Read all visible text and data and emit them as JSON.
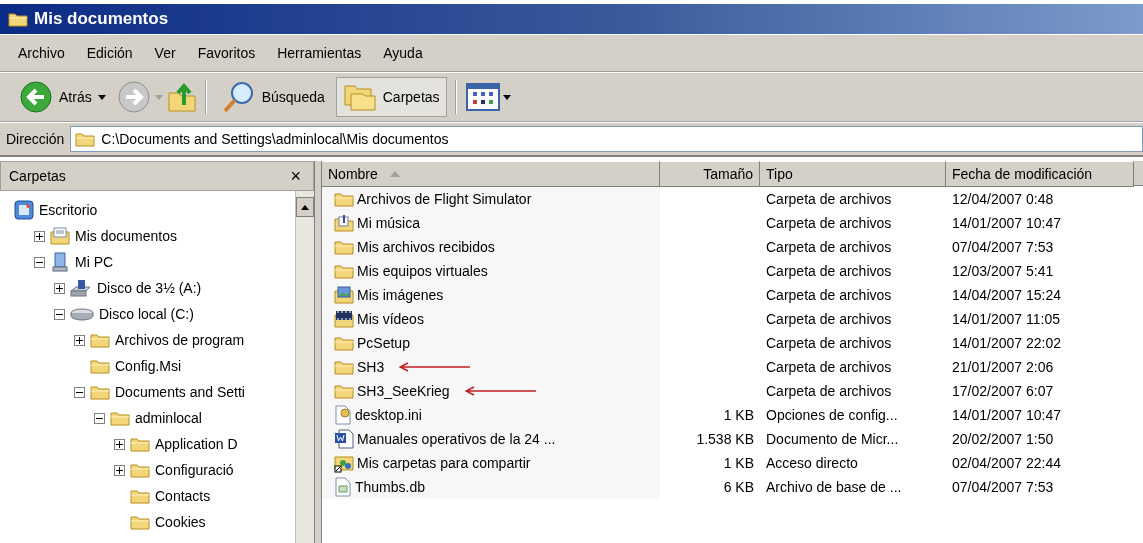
{
  "window": {
    "title": "Mis documentos"
  },
  "menu": [
    "Archivo",
    "Edición",
    "Ver",
    "Favoritos",
    "Herramientas",
    "Ayuda"
  ],
  "toolbar": {
    "back": "Atrás",
    "search": "Búsqueda",
    "folders": {
      "label": "Carpetas",
      "pressed": true
    }
  },
  "address": {
    "label": "Dirección",
    "value": "C:\\Documents and Settings\\adminlocal\\Mis documentos"
  },
  "folders_pane": {
    "title": "Carpetas",
    "close": "×",
    "tree": [
      {
        "label": "Escritorio",
        "kind": "desktop",
        "children": [
          {
            "label": "Mis documentos",
            "kind": "documents",
            "expanded": false
          },
          {
            "label": "Mi PC",
            "kind": "computer",
            "expanded": true,
            "children": [
              {
                "label": "Disco de 3½ (A:)",
                "kind": "floppy",
                "expanded": false
              },
              {
                "label": "Disco local (C:)",
                "kind": "drive",
                "expanded": true,
                "children": [
                  {
                    "label": "Archivos de program",
                    "kind": "folder",
                    "expanded": false
                  },
                  {
                    "label": "Config.Msi",
                    "kind": "folder"
                  },
                  {
                    "label": "Documents and Setti",
                    "kind": "folder",
                    "expanded": true,
                    "children": [
                      {
                        "label": "adminlocal",
                        "kind": "folder",
                        "expanded": true,
                        "children": [
                          {
                            "label": "Application D",
                            "kind": "folder",
                            "expanded": false
                          },
                          {
                            "label": "Configuració",
                            "kind": "folder",
                            "expanded": false
                          },
                          {
                            "label": "Contacts",
                            "kind": "folder"
                          },
                          {
                            "label": "Cookies",
                            "kind": "folder"
                          }
                        ]
                      }
                    ]
                  }
                ]
              }
            ]
          }
        ]
      }
    ]
  },
  "table": {
    "columns": [
      {
        "label": "Nombre",
        "sorted": true
      },
      {
        "label": "Tamaño",
        "sorted": false
      },
      {
        "label": "Tipo",
        "sorted": false
      },
      {
        "label": "Fecha de modificación",
        "sorted": false
      }
    ],
    "rows": [
      {
        "kind": "folder",
        "name": "Archivos de Flight Simulator",
        "size": "",
        "type": "Carpeta de archivos",
        "date": "12/04/2007 0:48",
        "arrow": false
      },
      {
        "kind": "music",
        "name": "Mi música",
        "size": "",
        "type": "Carpeta de archivos",
        "date": "14/01/2007 10:47",
        "arrow": false
      },
      {
        "kind": "folder",
        "name": "Mis archivos recibidos",
        "size": "",
        "type": "Carpeta de archivos",
        "date": "07/04/2007 7:53",
        "arrow": false
      },
      {
        "kind": "folder",
        "name": "Mis equipos virtuales",
        "size": "",
        "type": "Carpeta de archivos",
        "date": "12/03/2007 5:41",
        "arrow": false
      },
      {
        "kind": "pictures",
        "name": "Mis imágenes",
        "size": "",
        "type": "Carpeta de archivos",
        "date": "14/04/2007 15:24",
        "arrow": false
      },
      {
        "kind": "videos",
        "name": "Mis vídeos",
        "size": "",
        "type": "Carpeta de archivos",
        "date": "14/01/2007 11:05",
        "arrow": false
      },
      {
        "kind": "folder",
        "name": "PcSetup",
        "size": "",
        "type": "Carpeta de archivos",
        "date": "14/01/2007 22:02",
        "arrow": false
      },
      {
        "kind": "folder",
        "name": "SH3",
        "size": "",
        "type": "Carpeta de archivos",
        "date": "21/01/2007 2:06",
        "arrow": true
      },
      {
        "kind": "folder",
        "name": "SH3_SeeKrieg",
        "size": "",
        "type": "Carpeta de archivos",
        "date": "17/02/2007 6:07",
        "arrow": true
      },
      {
        "kind": "settings",
        "name": "desktop.ini",
        "size": "1 KB",
        "type": "Opciones de config...",
        "date": "14/01/2007 10:47",
        "arrow": false
      },
      {
        "kind": "word",
        "name": "Manuales operativos de la 24 ...",
        "size": "1.538 KB",
        "type": "Documento de Micr...",
        "date": "20/02/2007 1:50",
        "arrow": false
      },
      {
        "kind": "shared",
        "name": "Mis carpetas para compartir",
        "size": "1 KB",
        "type": "Acceso directo",
        "date": "02/04/2007 22:44",
        "arrow": false
      },
      {
        "kind": "file",
        "name": "Thumbs.db",
        "size": "6 KB",
        "type": "Archivo de base de ...",
        "date": "07/04/2007 7:53",
        "arrow": false
      }
    ]
  }
}
